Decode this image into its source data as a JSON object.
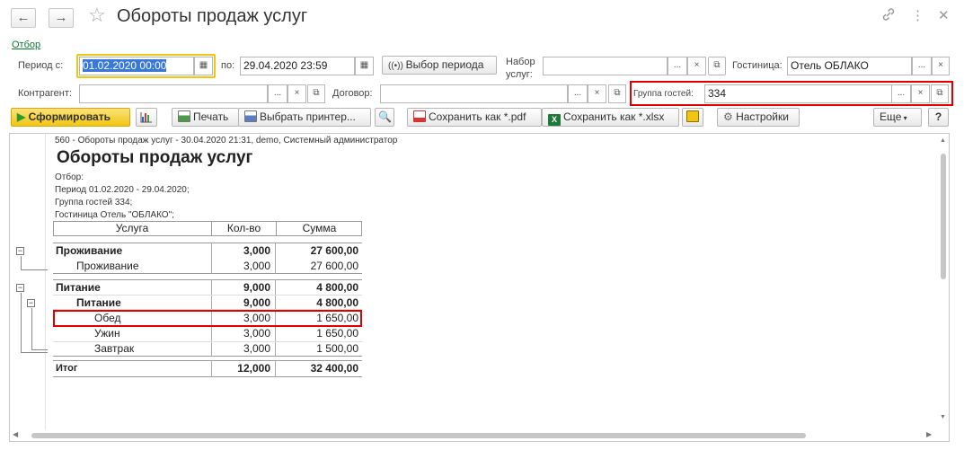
{
  "window": {
    "title": "Обороты продаж услуг",
    "back_icon": "←",
    "forward_icon": "→",
    "star_icon": "☆",
    "link_icon": "🔗",
    "more_icon": "⋮",
    "close_icon": "✕"
  },
  "filter_link": "Отбор",
  "filters": {
    "period_from_label": "Период с:",
    "period_from_value": "01.02.2020 00:00",
    "period_to_label": "по:",
    "period_to_value": "29.04.2020 23:59",
    "period_select_button": "Выбор периода",
    "service_set_label_1": "Набор",
    "service_set_label_2": "услуг:",
    "service_set_value": "",
    "hotel_label": "Гостиница:",
    "hotel_value": "Отель ОБЛАКО",
    "contractor_label": "Контрагент:",
    "contractor_value": "",
    "contract_label": "Договор:",
    "contract_value": "",
    "guest_group_label": "Группа гостей:",
    "guest_group_value": "334",
    "dots": "...",
    "clear": "×",
    "open": "⧉"
  },
  "toolbar": {
    "generate": "Сформировать",
    "print": "Печать",
    "choose_printer": "Выбрать принтер...",
    "save_pdf": "Сохранить как *.pdf",
    "save_xlsx": "Сохранить как *.xlsx",
    "settings": "Настройки",
    "more": "Еще",
    "help": "?"
  },
  "report": {
    "meta": "560 - Обороты продаж услуг - 30.04.2020 21:31, demo, Системный администратор",
    "title": "Обороты продаж услуг",
    "filter_header": "Отбор:",
    "filter_lines": [
      "Период 01.02.2020 - 29.04.2020;",
      "Группа гостей 334;",
      "Гостиница Отель \"ОБЛАКО\";"
    ],
    "columns": [
      "Услуга",
      "Кол-во",
      "Сумма"
    ],
    "rows": [
      {
        "name": "Проживание",
        "qty": "3,000",
        "sum": "27 600,00"
      },
      {
        "name": "Проживание",
        "qty": "3,000",
        "sum": "27 600,00"
      },
      {
        "name": "Питание",
        "qty": "9,000",
        "sum": "4 800,00"
      },
      {
        "name": "Питание",
        "qty": "9,000",
        "sum": "4 800,00"
      },
      {
        "name": "Обед",
        "qty": "3,000",
        "sum": "1 650,00"
      },
      {
        "name": "Ужин",
        "qty": "3,000",
        "sum": "1 650,00"
      },
      {
        "name": "Завтрак",
        "qty": "3,000",
        "sum": "1 500,00"
      }
    ],
    "total": {
      "name": "Итог",
      "qty": "12,000",
      "sum": "32 400,00"
    },
    "collapse": "−"
  },
  "colors": {
    "accent_yellow": "#f2c511",
    "highlight_red": "#e00000",
    "link_green": "#0a7a2f"
  }
}
